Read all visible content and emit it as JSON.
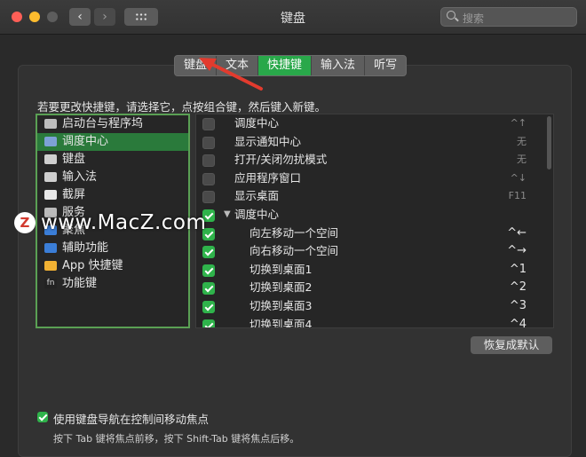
{
  "window": {
    "title": "键盘",
    "search_placeholder": "搜索"
  },
  "tabs": [
    {
      "label": "键盘",
      "active": false
    },
    {
      "label": "文本",
      "active": false
    },
    {
      "label": "快捷键",
      "active": true
    },
    {
      "label": "输入法",
      "active": false
    },
    {
      "label": "听写",
      "active": false
    }
  ],
  "instruction": "若要更改快捷键，请选择它，点按组合键，然后键入新键。",
  "categories": [
    {
      "label": "启动台与程序坞",
      "icon": "launchpad-icon",
      "selected": false
    },
    {
      "label": "调度中心",
      "icon": "mission-control-icon",
      "selected": true
    },
    {
      "label": "键盘",
      "icon": "keyboard-icon",
      "selected": false
    },
    {
      "label": "输入法",
      "icon": "input-method-icon",
      "selected": false
    },
    {
      "label": "截屏",
      "icon": "screenshot-icon",
      "selected": false
    },
    {
      "label": "服务",
      "icon": "gear-icon",
      "selected": false
    },
    {
      "label": "聚焦",
      "icon": "spotlight-icon",
      "selected": false
    },
    {
      "label": "辅助功能",
      "icon": "accessibility-icon",
      "selected": false
    },
    {
      "label": "App 快捷键",
      "icon": "app-shortcut-icon",
      "selected": false
    },
    {
      "label": "功能键",
      "icon": "fn-icon",
      "selected": false
    }
  ],
  "shortcuts": [
    {
      "label": "调度中心",
      "checked": false,
      "key": "^↑",
      "enabled": false,
      "sub": false,
      "group": false
    },
    {
      "label": "显示通知中心",
      "checked": false,
      "key": "无",
      "enabled": false,
      "sub": false,
      "group": false
    },
    {
      "label": "打开/关闭勿扰模式",
      "checked": false,
      "key": "无",
      "enabled": false,
      "sub": false,
      "group": false
    },
    {
      "label": "应用程序窗口",
      "checked": false,
      "key": "^↓",
      "enabled": false,
      "sub": false,
      "group": false
    },
    {
      "label": "显示桌面",
      "checked": false,
      "key": "F11",
      "enabled": false,
      "sub": false,
      "group": false
    },
    {
      "label": "调度中心",
      "checked": true,
      "key": "",
      "enabled": true,
      "sub": false,
      "group": true
    },
    {
      "label": "向左移动一个空间",
      "checked": true,
      "key": "^←",
      "enabled": true,
      "sub": true,
      "group": false
    },
    {
      "label": "向右移动一个空间",
      "checked": true,
      "key": "^→",
      "enabled": true,
      "sub": true,
      "group": false
    },
    {
      "label": "切换到桌面1",
      "checked": true,
      "key": "^1",
      "enabled": true,
      "sub": true,
      "group": false
    },
    {
      "label": "切换到桌面2",
      "checked": true,
      "key": "^2",
      "enabled": true,
      "sub": true,
      "group": false
    },
    {
      "label": "切换到桌面3",
      "checked": true,
      "key": "^3",
      "enabled": true,
      "sub": true,
      "group": false
    },
    {
      "label": "切换到桌面4",
      "checked": true,
      "key": "^4",
      "enabled": true,
      "sub": true,
      "group": false
    }
  ],
  "restore_button": "恢复成默认",
  "keyboard_nav": {
    "checked": true,
    "label": "使用键盘导航在控制间移动焦点",
    "hint": "按下 Tab 键将焦点前移，按下 Shift-Tab 键将焦点后移。"
  },
  "watermark": {
    "text": "www.MacZ.com",
    "logo": "Z"
  },
  "colors": {
    "accent": "#29a84a",
    "selection": "#2a7a3b",
    "focus_ring": "#5aa054",
    "arrow": "#e23b2e"
  }
}
